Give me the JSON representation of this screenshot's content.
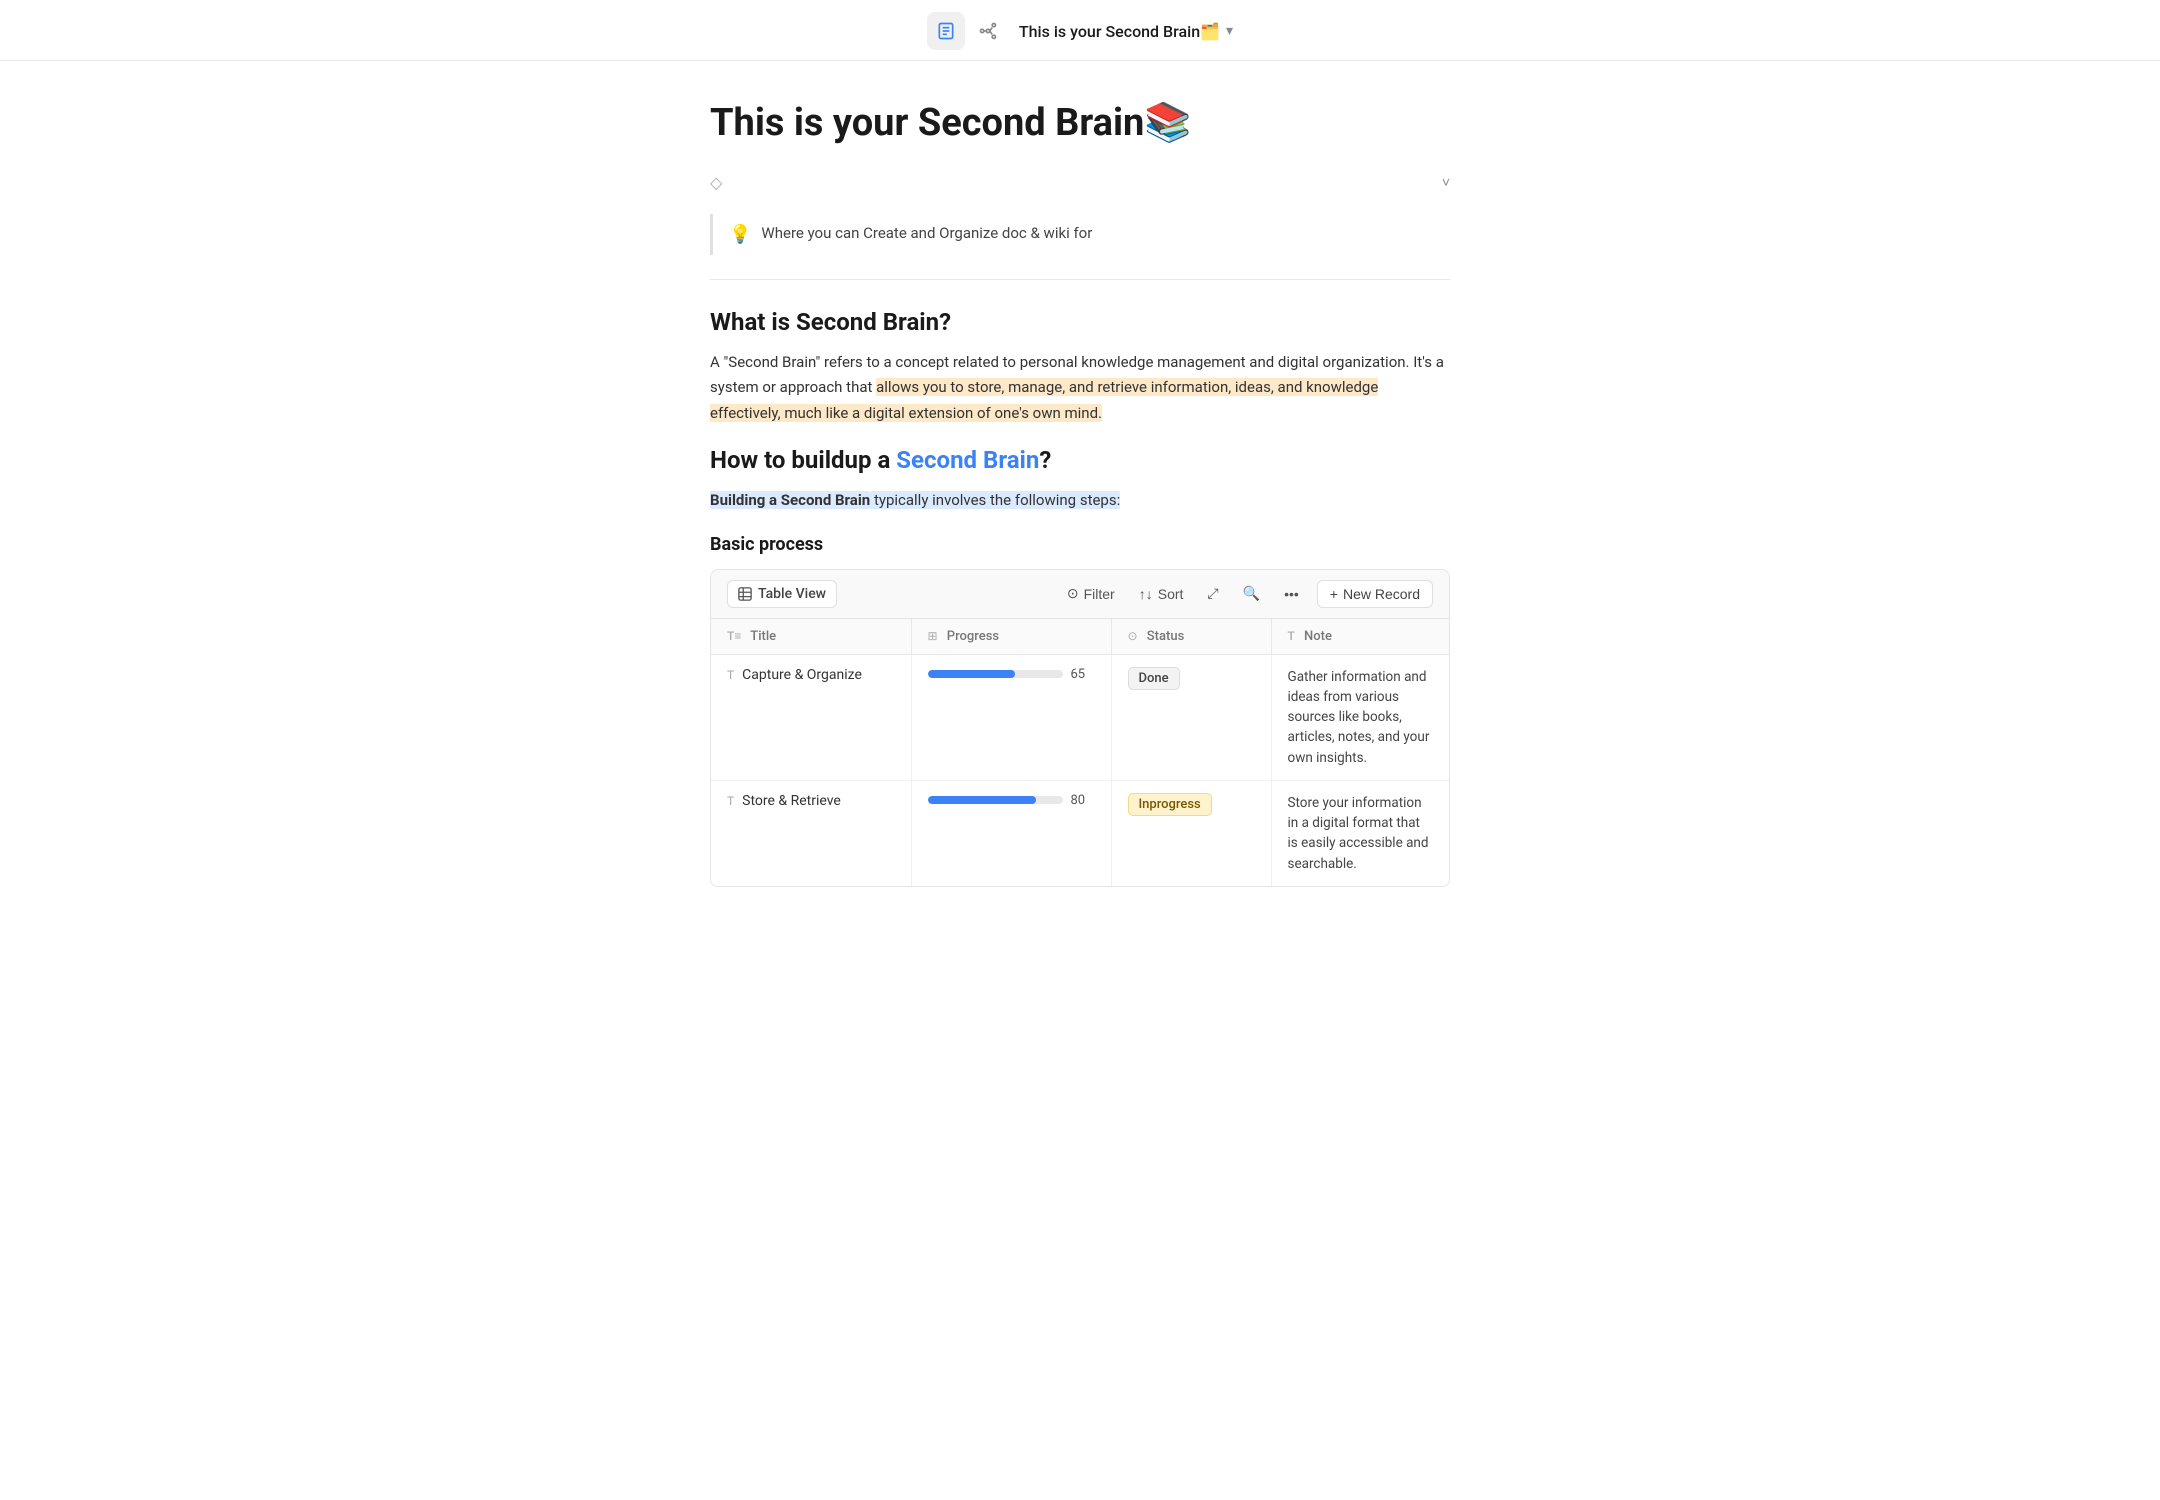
{
  "nav": {
    "title": "This is your Second Brain🗂️",
    "chevron": "▾",
    "doc_icon": "📄",
    "network_icon": "⎆"
  },
  "page": {
    "title": "This is your Second Brain📚",
    "properties_placeholder": "",
    "chevron": "˅",
    "callout_emoji": "💡",
    "callout_text": "Where you can Create and Organize doc & wiki  for"
  },
  "sections": {
    "what_heading": "What is Second Brain?",
    "what_body_before": "A \"Second Brain\" refers to a concept related to personal knowledge management and digital organization. It's a system or approach that ",
    "what_body_highlight": "allows you to store, manage, and retrieve information, ideas, and knowledge effectively, much like a digital extension of one's own mind.",
    "how_heading_prefix": "How to buildup a ",
    "how_heading_link": "Second Brain",
    "how_heading_suffix": "?",
    "steps_bold": "Building a Second Brain",
    "steps_highlight": " typically involves the following steps:",
    "basic_process_heading": "Basic process"
  },
  "toolbar": {
    "table_view_label": "Table View",
    "filter_label": "Filter",
    "sort_label": "Sort",
    "search_icon": "🔍",
    "more_icon": "•••",
    "new_record_label": "New Record"
  },
  "table": {
    "columns": [
      {
        "icon": "T≡",
        "label": "Title"
      },
      {
        "icon": "⊞",
        "label": "Progress"
      },
      {
        "icon": "⊙",
        "label": "Status"
      },
      {
        "icon": "T",
        "label": "Note"
      }
    ],
    "rows": [
      {
        "title": "Capture & Organize",
        "progress": 65,
        "status": "Done",
        "status_type": "done",
        "note": "Gather information and ideas from various sources like books, articles, notes, and your own insights."
      },
      {
        "title": "Store & Retrieve",
        "progress": 80,
        "status": "Inprogress",
        "status_type": "inprogress",
        "note": "Store your information in a digital format that is easily accessible and searchable."
      }
    ]
  }
}
